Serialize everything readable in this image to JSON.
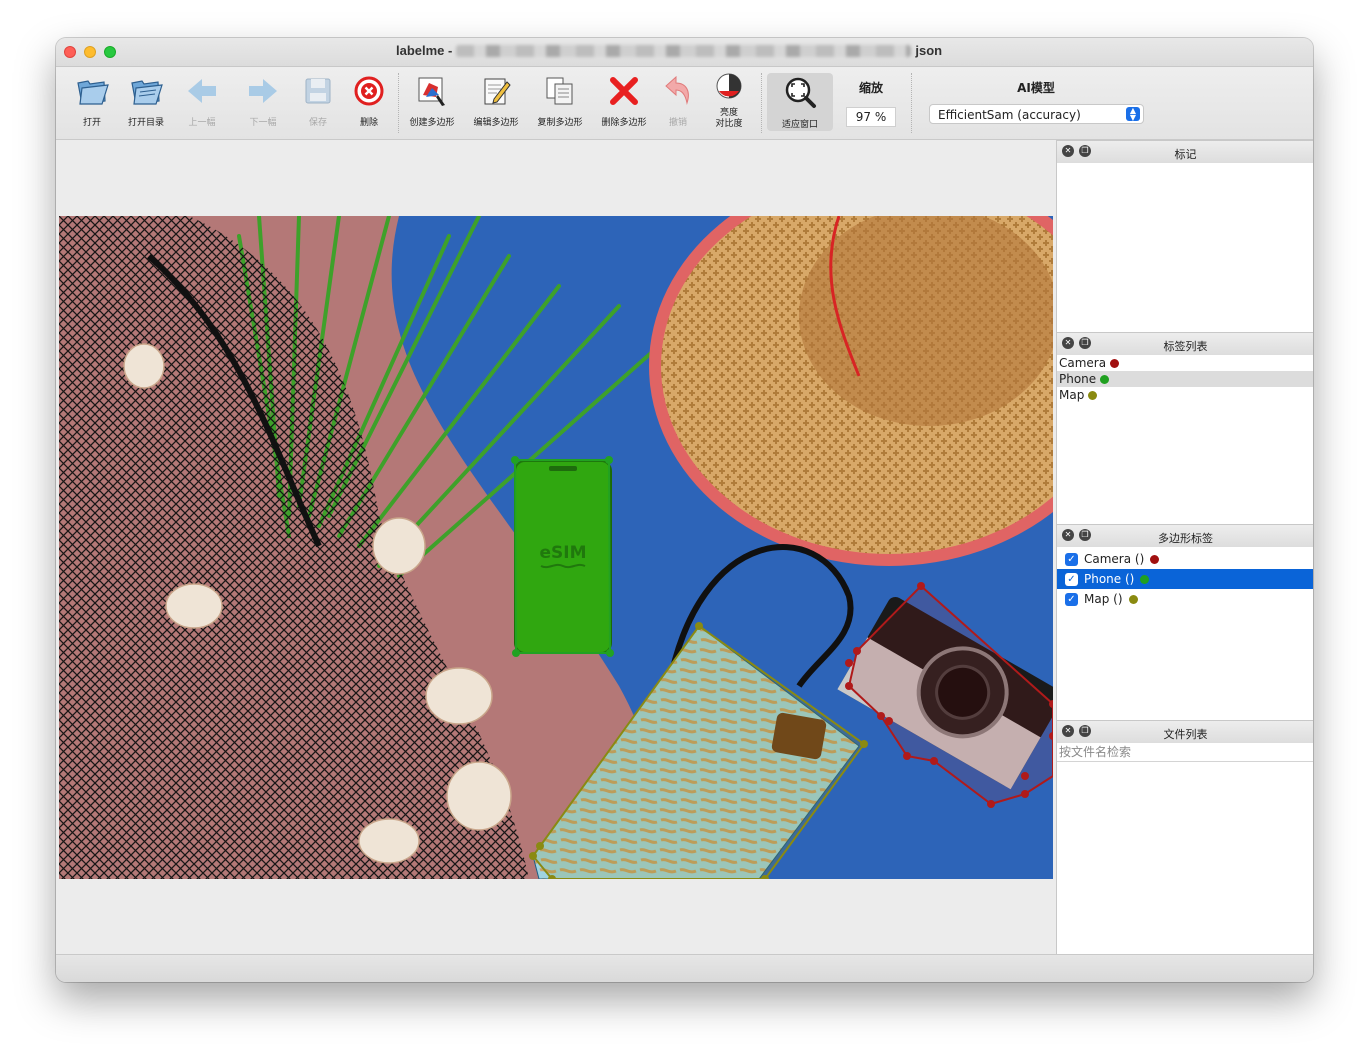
{
  "window": {
    "app_name": "labelme -",
    "title_suffix": "json"
  },
  "toolbar": {
    "open": "打开",
    "open_dir": "打开目录",
    "prev": "上一幅",
    "next": "下一幅",
    "save": "保存",
    "delete": "删除",
    "create_polygon": "创建多边形",
    "edit_polygon": "编辑多边形",
    "copy_polygon": "复制多边形",
    "delete_polygon": "删除多边形",
    "undo": "撤销",
    "brightness_line1": "亮度",
    "brightness_line2": "对比度",
    "fit_window": "适应窗口",
    "zoom_label": "缩放",
    "zoom_value": "97 %",
    "ai_label": "AI模型",
    "ai_model": "EfficientSam (accuracy)"
  },
  "docks": {
    "flags": {
      "title": "标记"
    },
    "label_list": {
      "title": "标签列表",
      "items": [
        {
          "label": "Camera",
          "color": "#a11010"
        },
        {
          "label": "Phone",
          "color": "#20a020"
        },
        {
          "label": "Map",
          "color": "#8a8a10"
        }
      ]
    },
    "polygon_labels": {
      "title": "多边形标签",
      "items": [
        {
          "label": "Camera ()",
          "color": "#a11010",
          "checked": true
        },
        {
          "label": "Phone ()",
          "color": "#20a020",
          "checked": true
        },
        {
          "label": "Map ()",
          "color": "#8a8a10",
          "checked": true
        }
      ]
    },
    "file_list": {
      "title": "文件列表",
      "search_placeholder": "按文件名检索"
    }
  },
  "annotations": {
    "phone_screen_text": "eSIM"
  },
  "colors": {
    "camera": "#b01a1a",
    "phone": "#22a222",
    "map": "#8a8a12",
    "selection": "#0a64d8"
  }
}
